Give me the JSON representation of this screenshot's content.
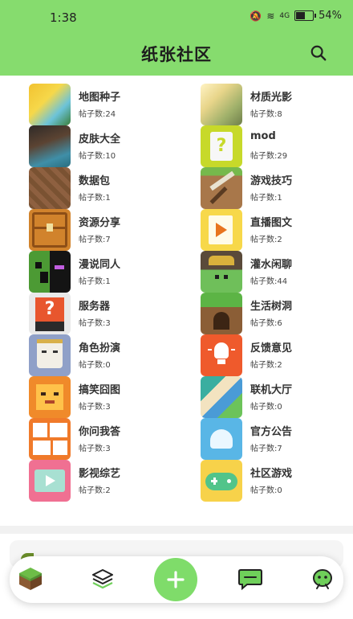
{
  "status_bar": {
    "time": "1:38",
    "battery": "54%",
    "signal": "4G"
  },
  "header": {
    "title": "纸张社区"
  },
  "colors": {
    "accent": "#86dc6e",
    "button": "#7fdc6a"
  },
  "count_prefix": "帖子数:",
  "categories": [
    {
      "name": "地图种子",
      "count": "帖子数:24",
      "icon": "map-seed-icon"
    },
    {
      "name": "材质光影",
      "count": "帖子数:8",
      "icon": "shader-icon"
    },
    {
      "name": "皮肤大全",
      "count": "帖子数:10",
      "icon": "skin-icon"
    },
    {
      "name": "mod",
      "count": "帖子数:29",
      "icon": "mod-icon"
    },
    {
      "name": "数据包",
      "count": "帖子数:1",
      "icon": "datapack-icon"
    },
    {
      "name": "游戏技巧",
      "count": "帖子数:1",
      "icon": "pickaxe-icon"
    },
    {
      "name": "资源分享",
      "count": "帖子数:7",
      "icon": "chest-icon"
    },
    {
      "name": "直播图文",
      "count": "帖子数:2",
      "icon": "live-icon"
    },
    {
      "name": "漫说同人",
      "count": "帖子数:1",
      "icon": "creeper-enderman-icon"
    },
    {
      "name": "灌水闲聊",
      "count": "帖子数:44",
      "icon": "miner-icon"
    },
    {
      "name": "服务器",
      "count": "帖子数:3",
      "icon": "server-icon"
    },
    {
      "name": "生活树洞",
      "count": "帖子数:6",
      "icon": "tree-hole-icon"
    },
    {
      "name": "角色扮演",
      "count": "帖子数:0",
      "icon": "roleplay-icon"
    },
    {
      "name": "反馈意见",
      "count": "帖子数:2",
      "icon": "lightbulb-icon"
    },
    {
      "name": "搞笑囧图",
      "count": "帖子数:3",
      "icon": "funny-icon"
    },
    {
      "name": "联机大厅",
      "count": "帖子数:0",
      "icon": "multiplayer-icon"
    },
    {
      "name": "你问我答",
      "count": "帖子数:3",
      "icon": "qa-icon"
    },
    {
      "name": "官方公告",
      "count": "帖子数:7",
      "icon": "announcement-icon"
    },
    {
      "name": "影视综艺",
      "count": "帖子数:2",
      "icon": "video-icon"
    },
    {
      "name": "社区游戏",
      "count": "帖子数:0",
      "icon": "gamepad-icon"
    }
  ],
  "bottom_nav": [
    {
      "icon": "grass-block-icon"
    },
    {
      "icon": "layers-icon"
    },
    {
      "icon": "add-icon"
    },
    {
      "icon": "chat-bubble-icon"
    },
    {
      "icon": "profile-icon"
    }
  ]
}
